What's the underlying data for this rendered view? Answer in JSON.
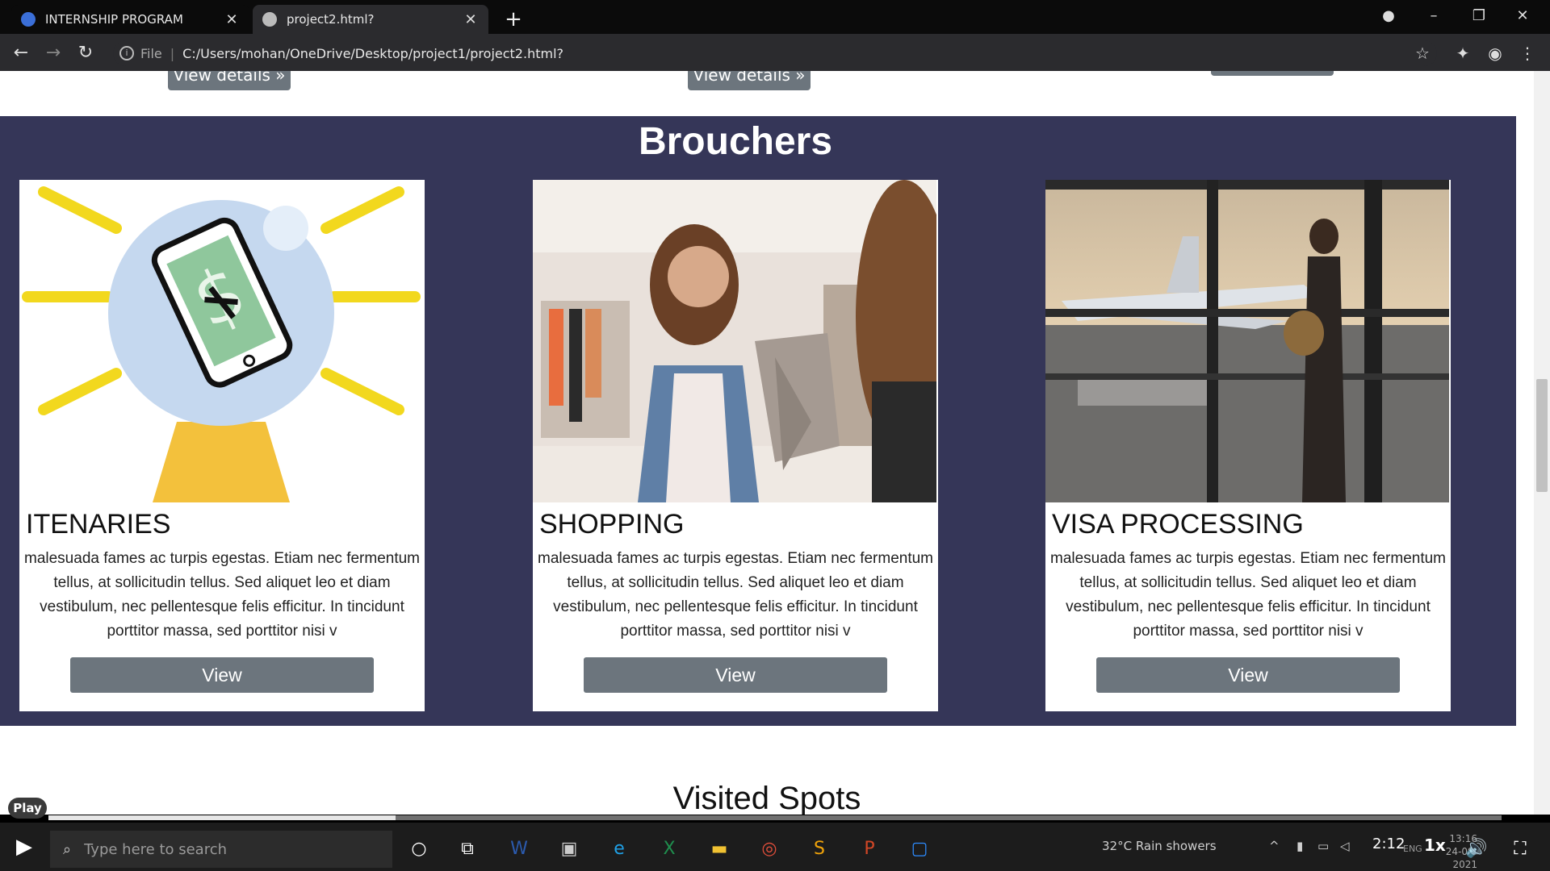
{
  "browser": {
    "tabs": [
      {
        "title": "INTERNSHIP PROGRAM",
        "active": false
      },
      {
        "title": "project2.html?",
        "active": true
      }
    ],
    "address": {
      "scheme": "File",
      "url": "C:/Users/mohan/OneDrive/Desktop/project1/project2.html?"
    }
  },
  "page": {
    "top_buttons": [
      "View details »",
      "View details »"
    ],
    "section_title": "Brouchers",
    "cards": [
      {
        "title": "ITENARIES",
        "body": "malesuada fames ac turpis egestas. Etiam nec fermentum tellus, at sollicitudin tellus. Sed aliquet leo et diam vestibulum, nec pellentesque felis efficitur. In tincidunt porttitor massa, sed porttitor nisi v",
        "button": "View"
      },
      {
        "title": "SHOPPING",
        "body": "malesuada fames ac turpis egestas. Etiam nec fermentum tellus, at sollicitudin tellus. Sed aliquet leo et diam vestibulum, nec pellentesque felis efficitur. In tincidunt porttitor massa, sed porttitor nisi v",
        "button": "View"
      },
      {
        "title": "VISA PROCESSING",
        "body": "malesuada fames ac turpis egestas. Etiam nec fermentum tellus, at sollicitudin tellus. Sed aliquet leo et diam vestibulum, nec pellentesque felis efficitur. In tincidunt porttitor massa, sed porttitor nisi v",
        "button": "View"
      }
    ],
    "next_section_title": "Visited Spots"
  },
  "player": {
    "play_label": "Play",
    "time": "2:12",
    "speed": "1x"
  },
  "taskbar": {
    "search_placeholder": "Type here to search",
    "weather": "32°C  Rain showers",
    "lang": "ENG",
    "clock_time": "13:16",
    "clock_date": "24-09-2021"
  },
  "colors": {
    "section_bg": "#353658",
    "button_bg": "#6c757d"
  }
}
